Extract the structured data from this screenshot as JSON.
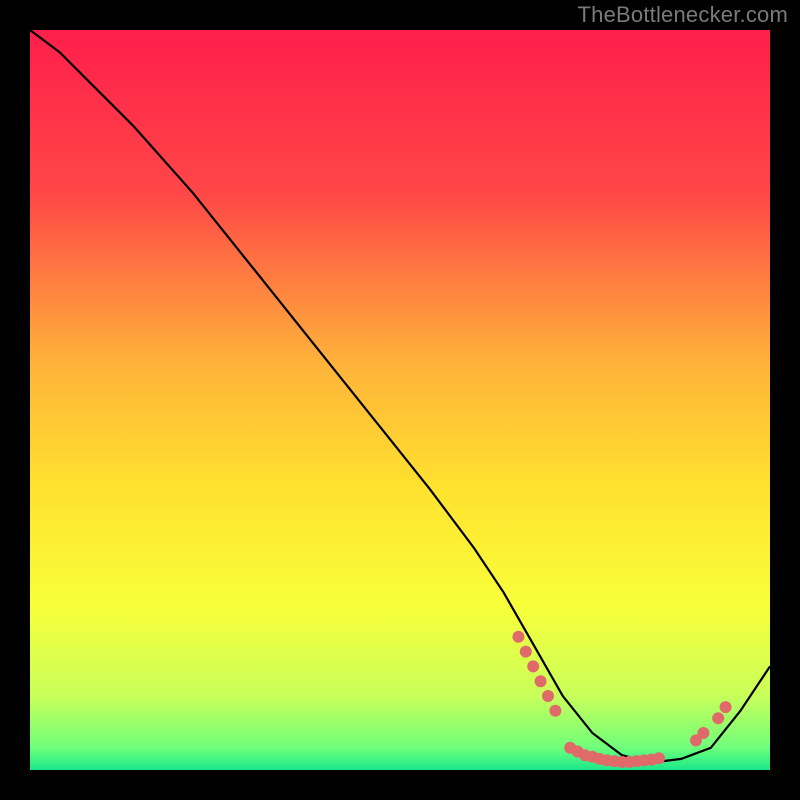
{
  "watermark": "TheBottlenecker.com",
  "chart_data": {
    "type": "line",
    "title": "",
    "xlabel": "",
    "ylabel": "",
    "xlim": [
      0,
      100
    ],
    "ylim": [
      0,
      100
    ],
    "background_gradient": {
      "stops": [
        {
          "pct": 0,
          "color": "#ff1e4b"
        },
        {
          "pct": 22,
          "color": "#ff4747"
        },
        {
          "pct": 45,
          "color": "#ffb23a"
        },
        {
          "pct": 62,
          "color": "#ffe22e"
        },
        {
          "pct": 78,
          "color": "#f8ff3a"
        },
        {
          "pct": 90,
          "color": "#c8ff5a"
        },
        {
          "pct": 97,
          "color": "#6fff7a"
        },
        {
          "pct": 100,
          "color": "#18e88a"
        }
      ]
    },
    "series": [
      {
        "name": "bottleneck-curve",
        "color": "#000000",
        "x": [
          0,
          4,
          8,
          14,
          22,
          30,
          38,
          46,
          54,
          60,
          64,
          68,
          72,
          76,
          80,
          84,
          88,
          92,
          96,
          100
        ],
        "y": [
          100,
          97,
          93,
          87,
          78,
          68,
          58,
          48,
          38,
          30,
          24,
          17,
          10,
          5,
          2,
          1,
          1.5,
          3,
          8,
          14
        ]
      }
    ],
    "markers": [
      {
        "name": "cluster-a",
        "color": "#e06a6a",
        "x": 66,
        "y": 18
      },
      {
        "name": "cluster-a",
        "color": "#e06a6a",
        "x": 67,
        "y": 16
      },
      {
        "name": "cluster-a",
        "color": "#e06a6a",
        "x": 68,
        "y": 14
      },
      {
        "name": "cluster-a",
        "color": "#e06a6a",
        "x": 69,
        "y": 12
      },
      {
        "name": "cluster-a",
        "color": "#e06a6a",
        "x": 70,
        "y": 10
      },
      {
        "name": "cluster-a",
        "color": "#e06a6a",
        "x": 71,
        "y": 8
      },
      {
        "name": "cluster-b",
        "color": "#e06a6a",
        "x": 73,
        "y": 3
      },
      {
        "name": "cluster-b",
        "color": "#e06a6a",
        "x": 74,
        "y": 2.5
      },
      {
        "name": "cluster-b",
        "color": "#e06a6a",
        "x": 75,
        "y": 2.0
      },
      {
        "name": "cluster-b",
        "color": "#e06a6a",
        "x": 76,
        "y": 1.8
      },
      {
        "name": "cluster-b",
        "color": "#e06a6a",
        "x": 77,
        "y": 1.5
      },
      {
        "name": "cluster-b",
        "color": "#e06a6a",
        "x": 78,
        "y": 1.3
      },
      {
        "name": "cluster-b",
        "color": "#e06a6a",
        "x": 79,
        "y": 1.2
      },
      {
        "name": "cluster-b",
        "color": "#e06a6a",
        "x": 80,
        "y": 1.1
      },
      {
        "name": "cluster-b",
        "color": "#e06a6a",
        "x": 81,
        "y": 1.1
      },
      {
        "name": "cluster-b",
        "color": "#e06a6a",
        "x": 82,
        "y": 1.2
      },
      {
        "name": "cluster-b",
        "color": "#e06a6a",
        "x": 83,
        "y": 1.3
      },
      {
        "name": "cluster-b",
        "color": "#e06a6a",
        "x": 84,
        "y": 1.4
      },
      {
        "name": "cluster-b",
        "color": "#e06a6a",
        "x": 85,
        "y": 1.6
      },
      {
        "name": "cluster-c",
        "color": "#e06a6a",
        "x": 90,
        "y": 4.0
      },
      {
        "name": "cluster-c",
        "color": "#e06a6a",
        "x": 91,
        "y": 5.0
      },
      {
        "name": "cluster-c",
        "color": "#e06a6a",
        "x": 93,
        "y": 7.0
      },
      {
        "name": "cluster-c",
        "color": "#e06a6a",
        "x": 94,
        "y": 8.5
      }
    ]
  }
}
